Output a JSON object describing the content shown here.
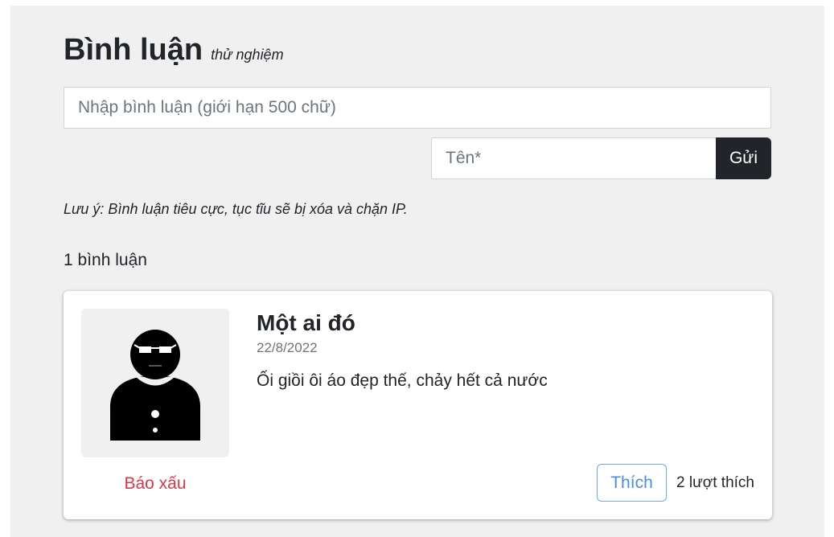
{
  "header": {
    "title": "Bình luận",
    "subtitle": "thử nghiệm"
  },
  "form": {
    "comment_placeholder": "Nhập bình luận (giới hạn 500 chữ)",
    "name_placeholder": "Tên*",
    "send_label": "Gửi",
    "note": "Lưu ý: Bình luận tiêu cực, tục tĩu sẽ bị xóa và chặn IP."
  },
  "comments": {
    "count_label": "1 bình luận",
    "items": [
      {
        "avatar_icon": "person-sunglasses-icon",
        "report_label": "Báo xấu",
        "author": "Một ai đó",
        "date": "22/8/2022",
        "text": "Ối giồi ôi áo đẹp thế, chảy hết cả nước",
        "like_label": "Thích",
        "like_count": "2 lượt thích"
      }
    ]
  },
  "colors": {
    "panel_bg": "#f0f0f0",
    "send_button_bg": "#212529",
    "report_text": "#dc3545",
    "like_button": "#6ea8fe"
  }
}
